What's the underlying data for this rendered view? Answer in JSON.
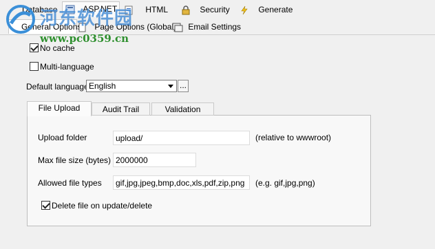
{
  "top_tabs": [
    {
      "label": "Database"
    },
    {
      "label": "ASP.NET"
    },
    {
      "label": "HTML"
    },
    {
      "label": "Security"
    },
    {
      "label": "Generate"
    }
  ],
  "sub_tabs": [
    {
      "label": "General Options"
    },
    {
      "label": "Page Options (Global)"
    },
    {
      "label": "Email Settings"
    }
  ],
  "watermark": {
    "title": "河东软件园",
    "url": "www.pc0359.cn"
  },
  "options": {
    "no_cache": {
      "label": "No cache",
      "checked": true
    },
    "multi_language": {
      "label": "Multi-language",
      "checked": false
    },
    "default_language": {
      "label": "Default language",
      "value": "English",
      "browse_label": "..."
    }
  },
  "inner_tabs": [
    {
      "label": "File Upload"
    },
    {
      "label": "Audit Trail"
    },
    {
      "label": "Validation"
    }
  ],
  "file_upload": {
    "upload_folder": {
      "label": "Upload folder",
      "value": "upload/",
      "hint": "(relative to wwwroot)"
    },
    "max_size": {
      "label": "Max file size (bytes)",
      "value": "2000000"
    },
    "allowed_types": {
      "label": "Allowed file types",
      "value": "gif,jpg,jpeg,bmp,doc,xls,pdf,zip,png",
      "hint": "(e.g. gif,jpg,png)"
    },
    "delete_on_update": {
      "label": "Delete file on update/delete",
      "checked": true
    }
  }
}
